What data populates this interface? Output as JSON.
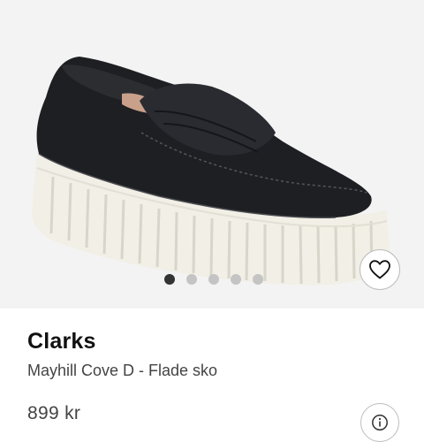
{
  "product": {
    "brand": "Clarks",
    "name": "Mayhill Cove D - Flade sko",
    "price": "899 kr"
  },
  "gallery": {
    "image_count": 5,
    "active_index": 0
  },
  "actions": {
    "favorite_icon": "heart-outline-icon",
    "info_icon": "info-icon"
  },
  "colors": {
    "gallery_bg": "#f3f3f3",
    "shoe_leather": "#1e1f23",
    "sole": "#f1efe6",
    "dot_active": "#333333",
    "dot_inactive": "#c4c4c4"
  }
}
